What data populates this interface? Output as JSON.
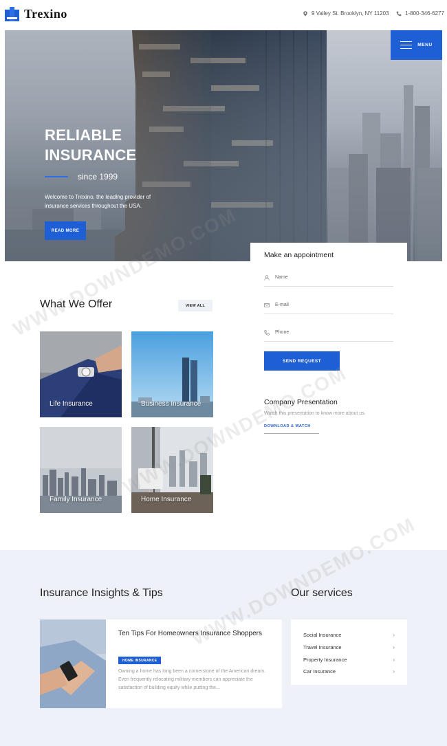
{
  "header": {
    "logo_text": "Trexino",
    "address": "9 Valley St. Brooklyn, NY 11203",
    "phone": "1-800-346-6277",
    "menu_label": "MENU"
  },
  "hero": {
    "title": "RELIABLE INSURANCE",
    "since": "since 1999",
    "description": "Welcome to Trexino, the leading provider of insurance services throughout the USA.",
    "button": "READ MORE"
  },
  "appointment": {
    "title": "Make an appointment",
    "name_placeholder": "Name",
    "email_placeholder": "E-mail",
    "phone_placeholder": "Phone",
    "button": "SEND REQUEST"
  },
  "company": {
    "title": "Company Presentation",
    "text": "Watch this presentation to know more about us.",
    "link": "DOWNLOAD & WATCH"
  },
  "offer": {
    "title": "What We Offer",
    "view_all": "VIEW ALL",
    "cards": [
      {
        "label": "Life Insurance"
      },
      {
        "label": "Business Insurance"
      },
      {
        "label": "Family Insurance"
      },
      {
        "label": "Home Insurance"
      }
    ]
  },
  "tips": {
    "title": "Insurance Insights & Tips",
    "article": {
      "title": "Ten Tips For Homeowners Insurance Shoppers",
      "tag": "HOME INSURANCE",
      "text": "Owning a home has long been a cornerstone of the American dream. Even frequently relocating military members can appreciate the satisfaction of building equity while putting the..."
    }
  },
  "services": {
    "title": "Our services",
    "items": [
      {
        "label": "Social Insurance"
      },
      {
        "label": "Travel Insurance"
      },
      {
        "label": "Property Insurance"
      },
      {
        "label": "Car Insurance"
      }
    ]
  },
  "watermark": "WWW.DOWNDEMO.COM",
  "colors": {
    "accent": "#1f5fd6",
    "section_bg": "#eef1f8"
  }
}
